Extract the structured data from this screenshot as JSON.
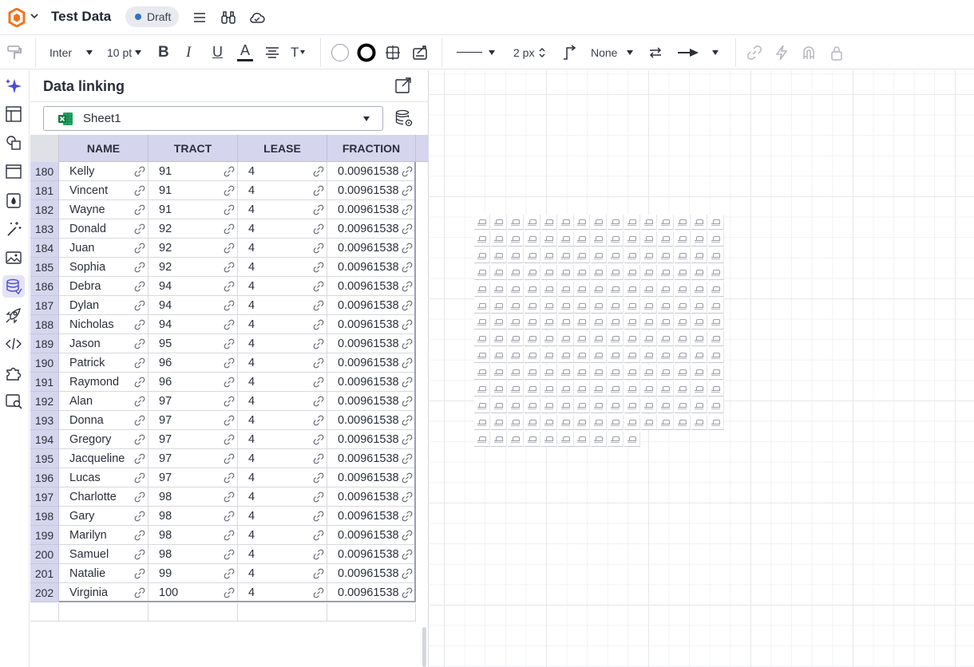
{
  "app": {
    "doc_title": "Test Data",
    "status": "Draft",
    "colors": {
      "accent": "#4b4bd6",
      "header_fill": "#d5d6ee",
      "draft_dot": "#2a74c9",
      "logo_orange": "#f2731c"
    }
  },
  "topbar": {
    "icons": [
      "logo-icon",
      "chevron-down-icon",
      "menu-icon",
      "binoculars-icon",
      "cloud-icon"
    ]
  },
  "toolbar": {
    "font_family": "Inter",
    "font_size": "10 pt",
    "bold_label": "B",
    "italic_label": "I",
    "underline_label": "U",
    "font_color_label": "A",
    "line_width": "2 px",
    "line_end": "None",
    "icons": [
      "paint-format-icon",
      "align-icon",
      "text-size-icon",
      "fill-color-icon",
      "line-color-icon",
      "border-icon",
      "shape-style-icon",
      "line-style-icon",
      "connector-icon",
      "swap-icon",
      "arrow-end-icon",
      "link-icon",
      "lightning-icon",
      "magnet-icon",
      "lock-icon"
    ]
  },
  "rail": {
    "icons": [
      "sparkle-icon",
      "template-icon",
      "shapes-icon",
      "frame-icon",
      "fill-drop-icon",
      "magic-wand-icon",
      "image-icon",
      "data-linking-icon",
      "rocket-icon",
      "code-icon",
      "puzzle-icon",
      "image-search-icon"
    ],
    "active": "data-linking-icon"
  },
  "panel": {
    "title": "Data linking",
    "sheet": "Sheet1",
    "columns": [
      "NAME",
      "TRACT",
      "LEASE",
      "FRACTION"
    ],
    "rows": [
      {
        "num": "180",
        "name": "Kelly",
        "tract": "91",
        "lease": "4",
        "fraction": "0.00961538"
      },
      {
        "num": "181",
        "name": "Vincent",
        "tract": "91",
        "lease": "4",
        "fraction": "0.00961538"
      },
      {
        "num": "182",
        "name": "Wayne",
        "tract": "91",
        "lease": "4",
        "fraction": "0.00961538"
      },
      {
        "num": "183",
        "name": "Donald",
        "tract": "92",
        "lease": "4",
        "fraction": "0.00961538"
      },
      {
        "num": "184",
        "name": "Juan",
        "tract": "92",
        "lease": "4",
        "fraction": "0.00961538"
      },
      {
        "num": "185",
        "name": "Sophia",
        "tract": "92",
        "lease": "4",
        "fraction": "0.00961538"
      },
      {
        "num": "186",
        "name": "Debra",
        "tract": "94",
        "lease": "4",
        "fraction": "0.00961538"
      },
      {
        "num": "187",
        "name": "Dylan",
        "tract": "94",
        "lease": "4",
        "fraction": "0.00961538"
      },
      {
        "num": "188",
        "name": "Nicholas",
        "tract": "94",
        "lease": "4",
        "fraction": "0.00961538"
      },
      {
        "num": "189",
        "name": "Jason",
        "tract": "95",
        "lease": "4",
        "fraction": "0.00961538"
      },
      {
        "num": "190",
        "name": "Patrick",
        "tract": "96",
        "lease": "4",
        "fraction": "0.00961538"
      },
      {
        "num": "191",
        "name": "Raymond",
        "tract": "96",
        "lease": "4",
        "fraction": "0.00961538"
      },
      {
        "num": "192",
        "name": "Alan",
        "tract": "97",
        "lease": "4",
        "fraction": "0.00961538"
      },
      {
        "num": "193",
        "name": "Donna",
        "tract": "97",
        "lease": "4",
        "fraction": "0.00961538"
      },
      {
        "num": "194",
        "name": "Gregory",
        "tract": "97",
        "lease": "4",
        "fraction": "0.00961538"
      },
      {
        "num": "195",
        "name": "Jacqueline",
        "tract": "97",
        "lease": "4",
        "fraction": "0.00961538"
      },
      {
        "num": "196",
        "name": "Lucas",
        "tract": "97",
        "lease": "4",
        "fraction": "0.00961538"
      },
      {
        "num": "197",
        "name": "Charlotte",
        "tract": "98",
        "lease": "4",
        "fraction": "0.00961538"
      },
      {
        "num": "198",
        "name": "Gary",
        "tract": "98",
        "lease": "4",
        "fraction": "0.00961538"
      },
      {
        "num": "199",
        "name": "Marilyn",
        "tract": "98",
        "lease": "4",
        "fraction": "0.00961538"
      },
      {
        "num": "200",
        "name": "Samuel",
        "tract": "98",
        "lease": "4",
        "fraction": "0.00961538"
      },
      {
        "num": "201",
        "name": "Natalie",
        "tract": "99",
        "lease": "4",
        "fraction": "0.00961538"
      },
      {
        "num": "202",
        "name": "Virginia",
        "tract": "100",
        "lease": "4",
        "fraction": "0.00961538"
      }
    ]
  },
  "canvas": {
    "linked_shape_count": 205
  }
}
